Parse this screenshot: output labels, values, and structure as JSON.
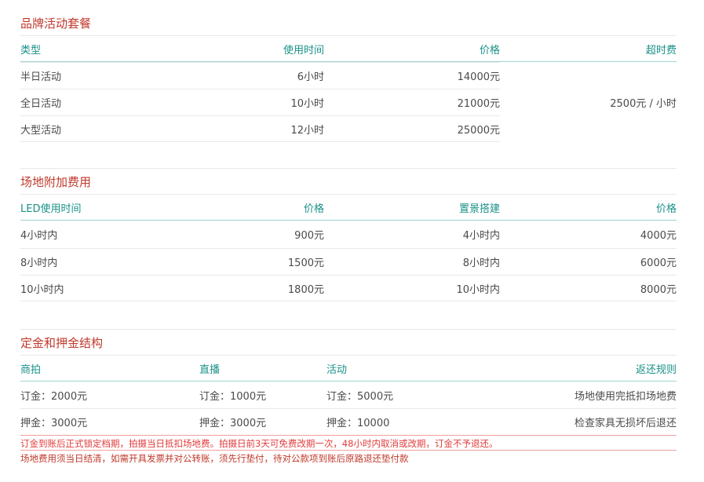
{
  "brand": {
    "title": "品牌活动套餐",
    "headers": [
      "类型",
      "使用时间",
      "价格",
      "超时费"
    ],
    "rows": [
      [
        "半日活动",
        "6小时",
        "14000元"
      ],
      [
        "全日活动",
        "10小时",
        "21000元"
      ],
      [
        "大型活动",
        "12小时",
        "25000元"
      ]
    ],
    "overtime": "2500元 / 小时"
  },
  "extra": {
    "title": "场地附加费用",
    "headers": [
      "LED使用时间",
      "价格",
      "置景搭建",
      "价格"
    ],
    "rows": [
      [
        "4小时内",
        "900元",
        "4小时内",
        "4000元"
      ],
      [
        "8小时内",
        "1500元",
        "8小时内",
        "6000元"
      ],
      [
        "10小时内",
        "1800元",
        "10小时内",
        "8000元"
      ]
    ]
  },
  "deposit": {
    "title": "定金和押金结构",
    "headers": [
      "商拍",
      "直播",
      "活动",
      "返还规则"
    ],
    "rows": [
      [
        "订金：2000元",
        "订金：1000元",
        "订金：5000元",
        "场地使用完抵扣场地费"
      ],
      [
        "押金：3000元",
        "押金：3000元",
        "押金：10000",
        "检查家具无损坏后退还"
      ]
    ],
    "note1": "订金到账后正式锁定档期，拍摄当日抵扣场地费。拍摄日前3天可免费改期一次，48小时内取消或改期，订金不予退还。",
    "note2": "场地费用须当日结清，如需开具发票并对公转账，须先行垫付，待对公款项到账后原路退还垫付款"
  }
}
